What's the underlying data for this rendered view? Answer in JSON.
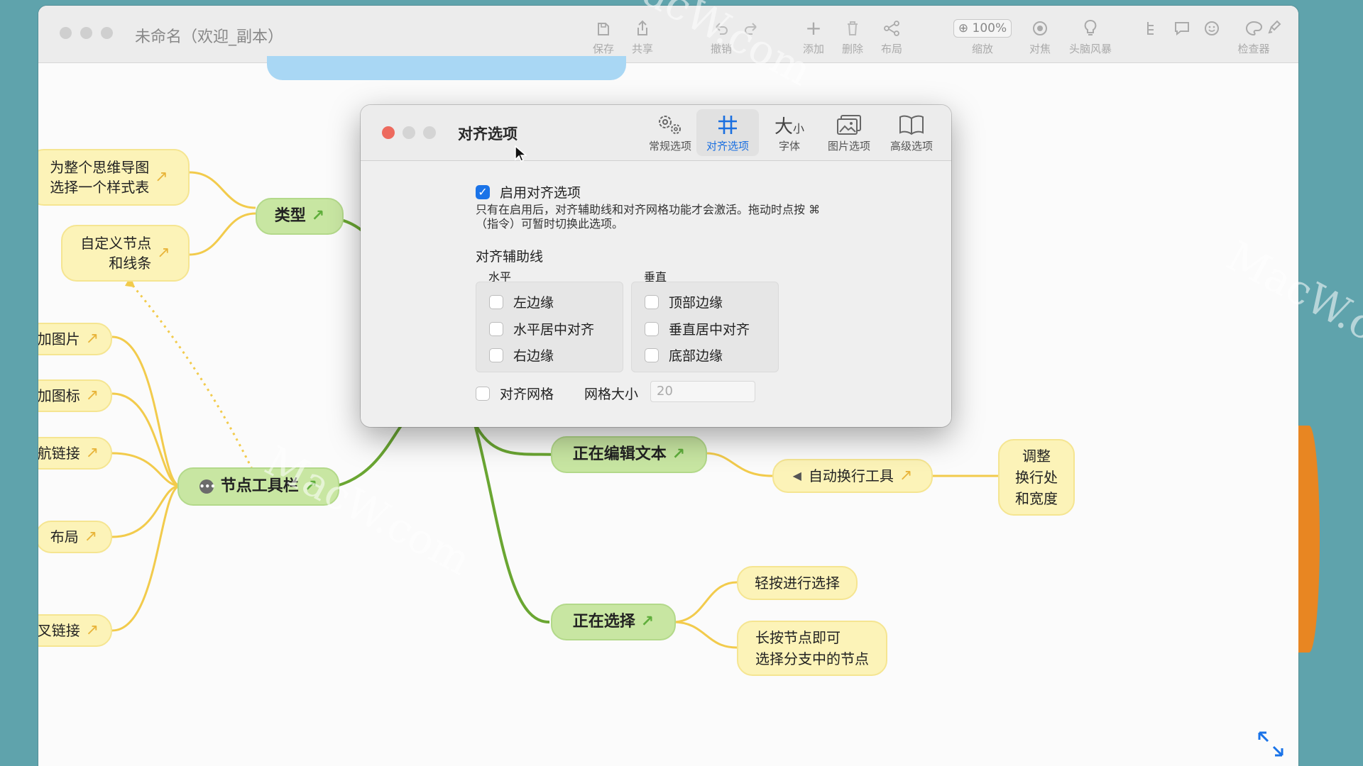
{
  "window": {
    "title": "未命名（欢迎_副本）"
  },
  "toolbar": {
    "save": "保存",
    "share": "共享",
    "undo": "撤销",
    "add": "添加",
    "delete": "删除",
    "layout": "布局",
    "zoom_value": "100%",
    "zoom": "缩放",
    "focus": "对焦",
    "brainstorm": "头脑风暴",
    "inspector": "检查器"
  },
  "dialog": {
    "title": "对齐选项",
    "tabs": [
      {
        "label": "常规选项",
        "icon": "gear-icon"
      },
      {
        "label": "对齐选项",
        "icon": "grid-hash-icon"
      },
      {
        "label": "字体",
        "icon": "font-size-icon"
      },
      {
        "label": "图片选项",
        "icon": "image-icon"
      },
      {
        "label": "高级选项",
        "icon": "book-icon"
      }
    ],
    "enable_label": "启用对齐选项",
    "enable_checked": true,
    "hint_line1": "只有在启用后，对齐辅助线和对齐网格功能才会激活。拖动时点按 ⌘",
    "hint_line2": "（指令）可暂时切换此选项。",
    "guides_title": "对齐辅助线",
    "horizontal_title": "水平",
    "vertical_title": "垂直",
    "horizontal": [
      "左边缘",
      "水平居中对齐",
      "右边缘"
    ],
    "vertical": [
      "顶部边缘",
      "垂直居中对齐",
      "底部边缘"
    ],
    "snap_grid_label": "对齐网格",
    "grid_size_label": "网格大小",
    "grid_size_value": "20"
  },
  "mindmap": {
    "sub_nodes": {
      "style_whole_1": "为整个思维导图",
      "style_whole_2": "选择一个样式表",
      "custom_1": "自定义节点",
      "custom_2": "和线条",
      "add_image": "加图片",
      "add_icon": "加图标",
      "nav_link": "航链接",
      "layout": "布局",
      "x_link": "叉链接",
      "auto_wrap": "自动换行工具",
      "adjust_1": "调整",
      "adjust_2": "换行处",
      "adjust_3": "和宽度",
      "tap_select": "轻按进行选择",
      "long_press_1": "长按节点即可",
      "long_press_2": "选择分支中的节点"
    },
    "main_nodes": {
      "type": "类型",
      "node_toolbar": "节点工具栏",
      "editing_text": "正在编辑文本",
      "selecting": "正在选择"
    }
  },
  "colors": {
    "accent": "#1a73e8",
    "branch_yellow": "#f2cb4c",
    "branch_green": "#6aa632"
  }
}
